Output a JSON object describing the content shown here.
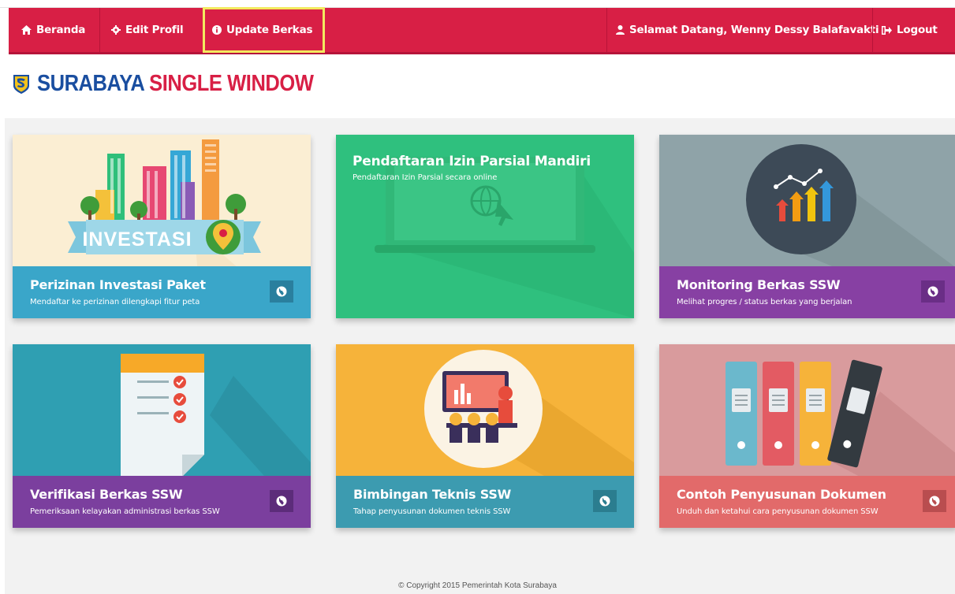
{
  "nav": {
    "beranda": "Beranda",
    "edit_profil": "Edit Profil",
    "update_berkas": "Update Berkas",
    "welcome": "Selamat Datang, Wenny Dessy Balafavakti",
    "logout": "Logout"
  },
  "logo": {
    "part1": "SURABAYA",
    "part2": "SINGLE WINDOW"
  },
  "cards": [
    {
      "title": "Perizinan Investasi Paket",
      "subtitle": "Mendaftar ke perizinan dilengkapi fitur peta",
      "art_label": "INVESTASI",
      "color": "#3aa6c9"
    },
    {
      "title": "Pendaftaran Izin Parsial Mandiri",
      "subtitle": "Pendaftaran Izin Parsial secara online",
      "color": "#2fc07e"
    },
    {
      "title": "Monitoring Berkas SSW",
      "subtitle": "Melihat progres / status berkas yang berjalan",
      "color": "#8740a3"
    },
    {
      "title": "Verifikasi Berkas SSW",
      "subtitle": "Pemeriksaan kelayakan administrasi berkas SSW",
      "color": "#7b3f9e"
    },
    {
      "title": "Bimbingan Teknis SSW",
      "subtitle": "Tahap penyusunan dokumen teknis SSW",
      "color": "#3c9bb0"
    },
    {
      "title": "Contoh Penyusunan Dokumen",
      "subtitle": "Unduh dan ketahui cara penyusunan dokumen SSW",
      "color": "#e26a6a"
    }
  ],
  "footer": "© Copyright 2015 Pemerintah Kota Surabaya",
  "colors": {
    "topbar": "#d81f45",
    "highlight": "#f3ea5f",
    "logo_blue": "#1a4ea0"
  }
}
